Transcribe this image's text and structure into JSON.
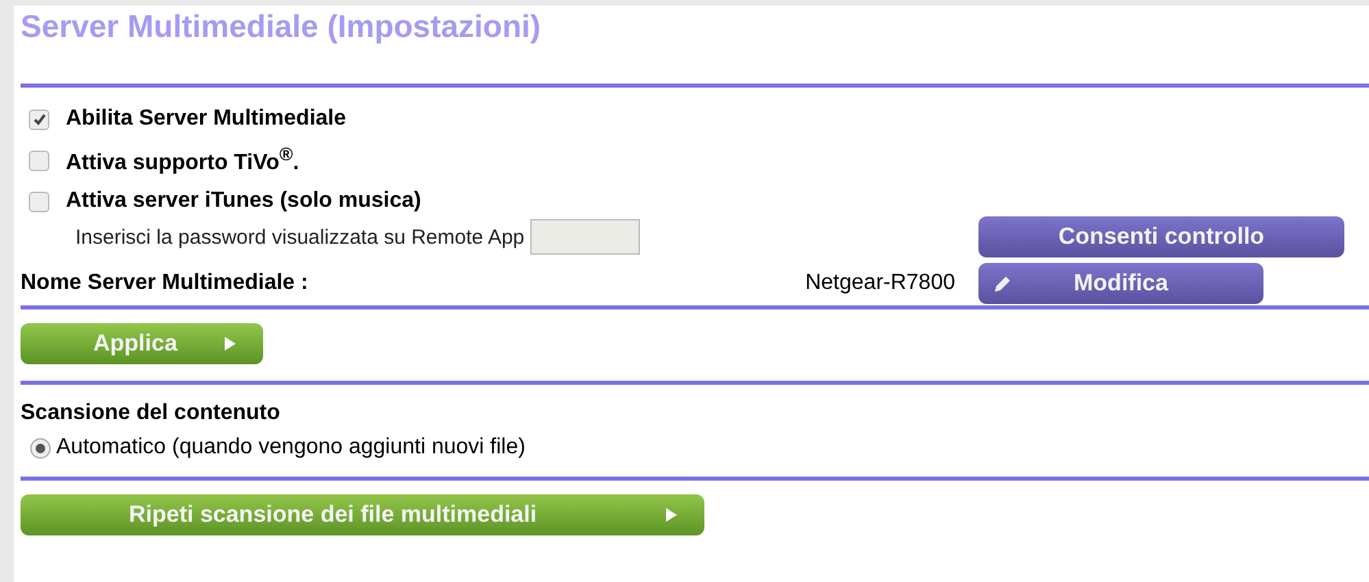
{
  "title": "Server Multimediale (Impostazioni)",
  "options": [
    {
      "label": "Abilita Server Multimediale",
      "checked": true
    },
    {
      "label": "Attiva supporto TiVo$^{®}$.",
      "checked": false
    },
    {
      "label": "Attiva server iTunes (solo musica)",
      "checked": false
    }
  ],
  "password": {
    "label": "Inserisci la password visualizzata su Remote App",
    "button": "Consenti controllo"
  },
  "server_name": {
    "label": "Nome Server Multimediale :",
    "value": "Netgear-R7800",
    "button": "Modifica"
  },
  "apply_button": "Applica",
  "scan": {
    "heading": "Scansione del contenuto",
    "options": [
      {
        "label": "Automatico (quando vengono aggiunti nuovi file)",
        "selected": true
      }
    ],
    "button": "Ripeti scansione dei file multimediali"
  }
}
